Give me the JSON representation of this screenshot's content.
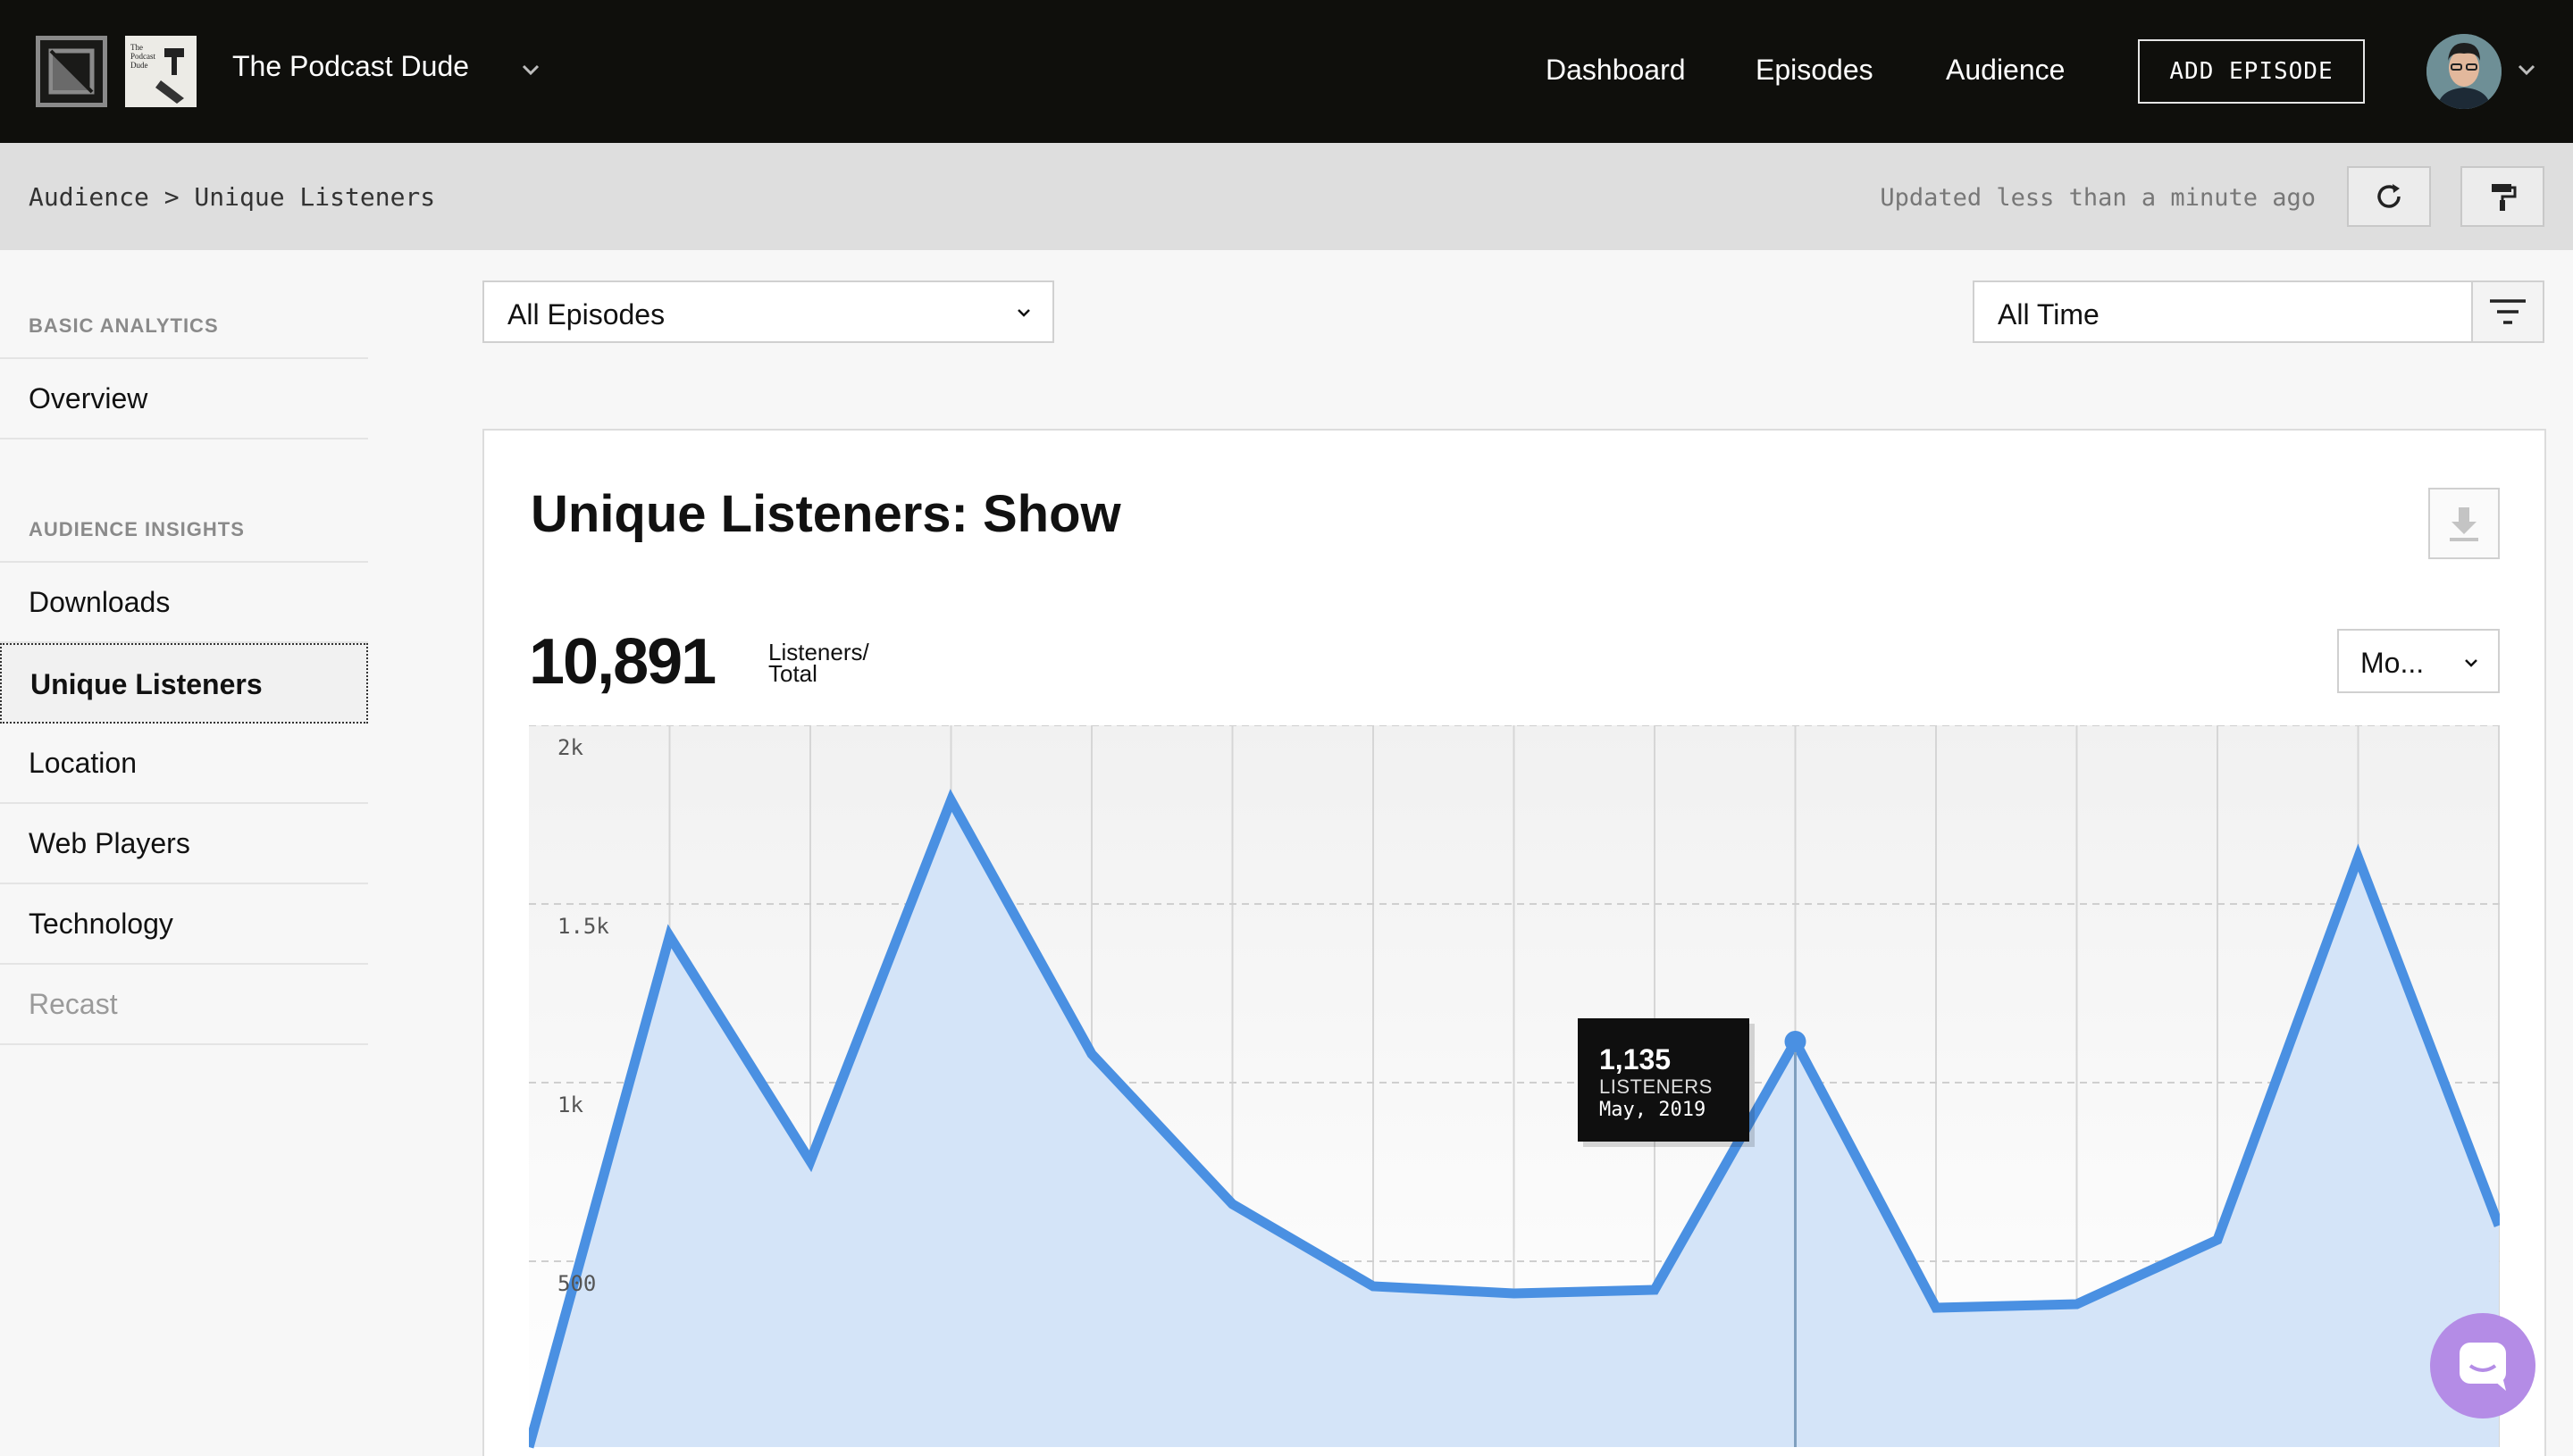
{
  "topbar": {
    "show_name": "The Podcast Dude",
    "show_thumb_text": "The Podcast Dude",
    "nav": [
      "Dashboard",
      "Episodes",
      "Audience"
    ],
    "add_episode_label": "ADD EPISODE"
  },
  "subbar": {
    "breadcrumb": "Audience > Unique Listeners",
    "updated": "Updated less than a minute ago"
  },
  "sidebar": {
    "basic_heading": "BASIC ANALYTICS",
    "basic_items": [
      "Overview"
    ],
    "insights_heading": "AUDIENCE INSIGHTS",
    "insights_items": [
      "Downloads",
      "Unique Listeners",
      "Location",
      "Web Players",
      "Technology",
      "Recast"
    ],
    "active_item": "Unique Listeners"
  },
  "filters": {
    "episodes_value": "All Episodes",
    "time_value": "All Time"
  },
  "card": {
    "title": "Unique Listeners: Show",
    "total_value": "10,891",
    "total_unit_line1": "Listeners/",
    "total_unit_line2": "Total",
    "period_value": "Mo..."
  },
  "tooltip": {
    "value": "1,135",
    "unit": "LISTENERS",
    "date": "May, 2019"
  },
  "colors": {
    "accent": "#4a90e2",
    "area_fill": "#d4e4f8",
    "topbar_bg": "#0f0f0c"
  },
  "icons": [
    "refresh-icon",
    "paint-roller-icon",
    "filter-icon",
    "download-icon",
    "chevron-down-icon",
    "chat-icon"
  ],
  "chart_data": {
    "type": "area",
    "title": "",
    "xlabel": "",
    "ylabel": "",
    "ylim": [
      0,
      2000
    ],
    "y_ticks": [
      "2k",
      "1.5k",
      "1k",
      "500"
    ],
    "y_tick_values": [
      2000,
      1500,
      1000,
      500
    ],
    "grid": true,
    "series": [
      {
        "values": [
          0,
          1430,
          800,
          1810,
          1100,
          680,
          450,
          430,
          440,
          1135,
          390,
          400,
          580,
          1650,
          620
        ]
      }
    ],
    "highlight_index": 9
  }
}
